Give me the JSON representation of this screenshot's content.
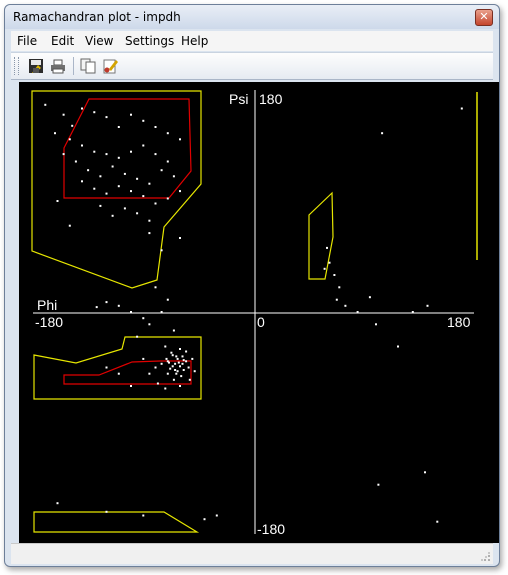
{
  "window": {
    "title": "Ramachandran plot - impdh"
  },
  "menu": [
    "File",
    "Edit",
    "View",
    "Settings",
    "Help"
  ],
  "toolbar": {
    "buttons": [
      {
        "name": "save-icon"
      },
      {
        "name": "print-icon"
      },
      {
        "name": "copy-icon"
      },
      {
        "name": "properties-icon"
      }
    ]
  },
  "plot": {
    "x_label": "Phi",
    "y_label": "Psi",
    "x_min_label": "-180",
    "x_zero_label": "0",
    "x_max_label": "180",
    "y_max_label": "180",
    "y_min_label": "-180",
    "colors": {
      "background": "#000000",
      "axes": "#ffffff",
      "allowed_region": "#e6e600",
      "favored_region": "#e00000",
      "points": "#ffffff"
    }
  },
  "chart_data": {
    "type": "scatter",
    "xlim": [
      -180,
      180
    ],
    "ylim": [
      -180,
      180
    ],
    "series": [
      {
        "values": [
          [
            -170,
            168
          ],
          [
            -155,
            160
          ],
          [
            -148,
            151
          ],
          [
            -162,
            145
          ],
          [
            -140,
            165
          ],
          [
            -130,
            162
          ],
          [
            -120,
            158
          ],
          [
            -110,
            150
          ],
          [
            -100,
            160
          ],
          [
            -90,
            155
          ],
          [
            -80,
            150
          ],
          [
            -70,
            145
          ],
          [
            -60,
            140
          ],
          [
            -150,
            140
          ],
          [
            -140,
            135
          ],
          [
            -130,
            130
          ],
          [
            -120,
            128
          ],
          [
            -110,
            125
          ],
          [
            -100,
            130
          ],
          [
            -90,
            135
          ],
          [
            -80,
            128
          ],
          [
            -70,
            122
          ],
          [
            -115,
            118
          ],
          [
            -105,
            112
          ],
          [
            -95,
            108
          ],
          [
            -85,
            104
          ],
          [
            -125,
            110
          ],
          [
            -135,
            115
          ],
          [
            -145,
            122
          ],
          [
            -155,
            128
          ],
          [
            -75,
            115
          ],
          [
            -65,
            110
          ],
          [
            -60,
            98
          ],
          [
            -70,
            92
          ],
          [
            -80,
            88
          ],
          [
            -90,
            94
          ],
          [
            -100,
            98
          ],
          [
            -110,
            102
          ],
          [
            -120,
            96
          ],
          [
            -130,
            100
          ],
          [
            -140,
            106
          ],
          [
            -105,
            84
          ],
          [
            -95,
            80
          ],
          [
            -85,
            74
          ],
          [
            -115,
            78
          ],
          [
            -125,
            86
          ],
          [
            -60,
            60
          ],
          [
            -75,
            50
          ],
          [
            -85,
            64
          ],
          [
            -150,
            70
          ],
          [
            -160,
            90
          ],
          [
            -80,
            20
          ],
          [
            -70,
            10
          ],
          [
            -90,
            -5
          ],
          [
            -100,
            0
          ],
          [
            -110,
            5
          ],
          [
            -120,
            8
          ],
          [
            -128,
            4
          ],
          [
            -75,
            0
          ],
          [
            -85,
            -10
          ],
          [
            -65,
            -15
          ],
          [
            -95,
            -20
          ],
          [
            -72,
            -28
          ],
          [
            -66,
            -35
          ],
          [
            -70,
            -40
          ],
          [
            -64,
            -42
          ],
          [
            -62,
            -38
          ],
          [
            -60,
            -44
          ],
          [
            -58,
            -36
          ],
          [
            -68,
            -46
          ],
          [
            -63,
            -50
          ],
          [
            -57,
            -47
          ],
          [
            -61,
            -41
          ],
          [
            -67,
            -33
          ],
          [
            -55,
            -40
          ],
          [
            -59,
            -52
          ],
          [
            -65,
            -55
          ],
          [
            -70,
            -50
          ],
          [
            -53,
            -45
          ],
          [
            -75,
            -42
          ],
          [
            -60,
            -30
          ],
          [
            -55,
            -32
          ],
          [
            -71,
            -38
          ],
          [
            -64,
            -47
          ],
          [
            -66,
            -44
          ],
          [
            -58,
            -42
          ],
          [
            -62,
            -48
          ],
          [
            -69,
            -41
          ],
          [
            -57,
            -39
          ],
          [
            -63,
            -36
          ],
          [
            -80,
            -45
          ],
          [
            -85,
            -50
          ],
          [
            -90,
            -38
          ],
          [
            -100,
            -60
          ],
          [
            -110,
            -50
          ],
          [
            -120,
            -45
          ],
          [
            -78,
            -58
          ],
          [
            -52,
            -55
          ],
          [
            -50,
            -38
          ],
          [
            -48,
            -48
          ],
          [
            -60,
            -60
          ],
          [
            -72,
            -62
          ],
          [
            62,
            40
          ],
          [
            60,
            52
          ],
          [
            58,
            35
          ],
          [
            66,
            30
          ],
          [
            70,
            20
          ],
          [
            68,
            10
          ],
          [
            75,
            5
          ],
          [
            85,
            0
          ],
          [
            95,
            12
          ],
          [
            130,
            0
          ],
          [
            142,
            5
          ],
          [
            100,
            -10
          ],
          [
            118,
            -28
          ],
          [
            140,
            -130
          ],
          [
            -160,
            -155
          ],
          [
            -120,
            -162
          ],
          [
            -90,
            -165
          ],
          [
            -40,
            -168
          ],
          [
            -30,
            -165
          ],
          [
            150,
            -170
          ],
          [
            102,
            -140
          ],
          [
            170,
            165
          ],
          [
            105,
            145
          ]
        ]
      }
    ]
  }
}
